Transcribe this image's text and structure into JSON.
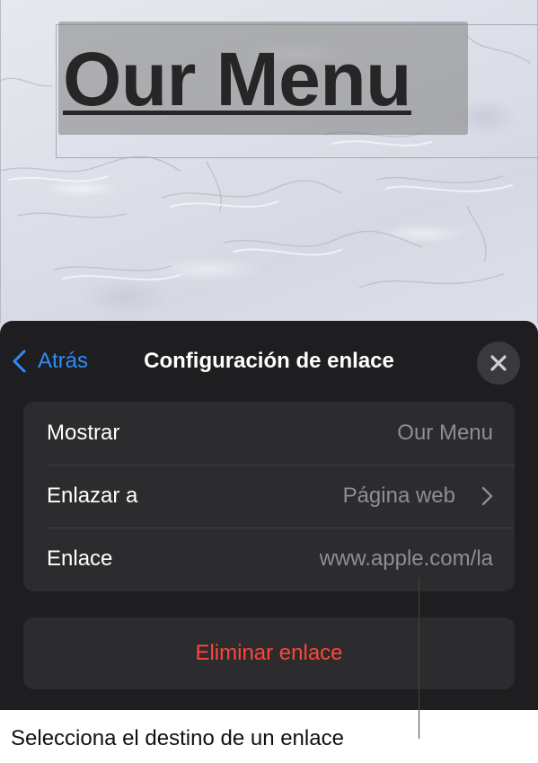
{
  "document": {
    "title": "Our Menu"
  },
  "link_settings": {
    "back_label": "Atrás",
    "title": "Configuración de enlace",
    "rows": [
      {
        "label": "Mostrar",
        "value": "Our Menu"
      },
      {
        "label": "Enlazar a",
        "value": "Página web"
      },
      {
        "label": "Enlace",
        "value": "www.apple.com/la"
      }
    ],
    "remove_label": "Eliminar enlace"
  },
  "callout": {
    "text": "Selecciona el destino de un enlace"
  },
  "icons": {
    "back": "chevron-left-icon",
    "close": "close-icon",
    "disclosure": "chevron-right-icon"
  },
  "colors": {
    "accent": "#2f8cf7",
    "destructive": "#ff453a",
    "sheet_background": "#1e1e20",
    "group_background": "#2c2c2e"
  }
}
